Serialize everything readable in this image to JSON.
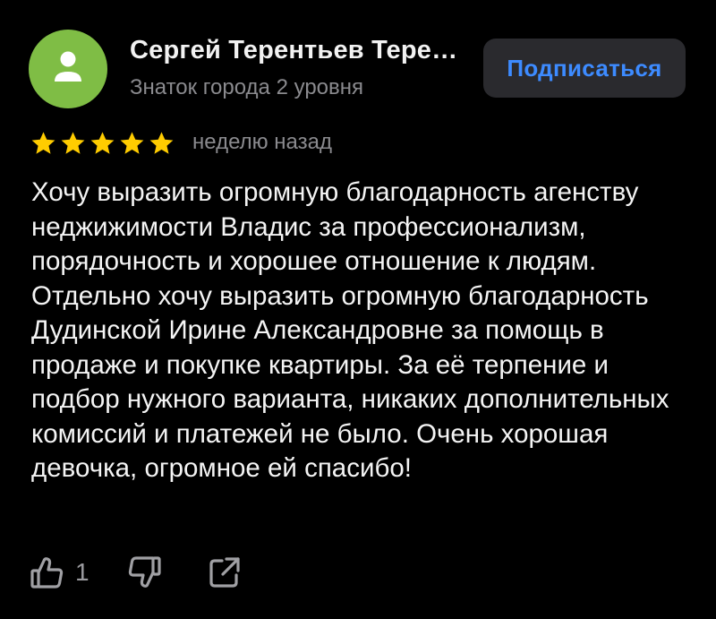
{
  "author": {
    "name": "Сергей Терентьев Тере…",
    "level": "Знаток города 2 уровня",
    "avatar_icon": "user-silhouette-icon",
    "avatar_color": "#7fbd45"
  },
  "subscribe_label": "Подписаться",
  "rating": {
    "stars": 5,
    "max": 5,
    "star_color": "#ffcc00"
  },
  "date": "неделю назад",
  "text": "Хочу выразить огромную благодарность агенству неджижимости Владис за профессионализм, порядочность и хорошее отношение к людям. Отдельно хочу выразить огромную благодарность Дудинской Ирине Александровне за помощь в продаже и покупке квартиры. За её терпение и подбор нужного варианта, никаких дополнительных комиссий и платежей не было. Очень хорошая девочка, огромное ей спасибо!",
  "actions": {
    "like_icon": "thumbs-up-icon",
    "like_count": "1",
    "dislike_icon": "thumbs-down-icon",
    "share_icon": "share-icon"
  },
  "colors": {
    "background": "#000000",
    "accent": "#3d8bff",
    "secondary_text": "#8a8a8e"
  }
}
